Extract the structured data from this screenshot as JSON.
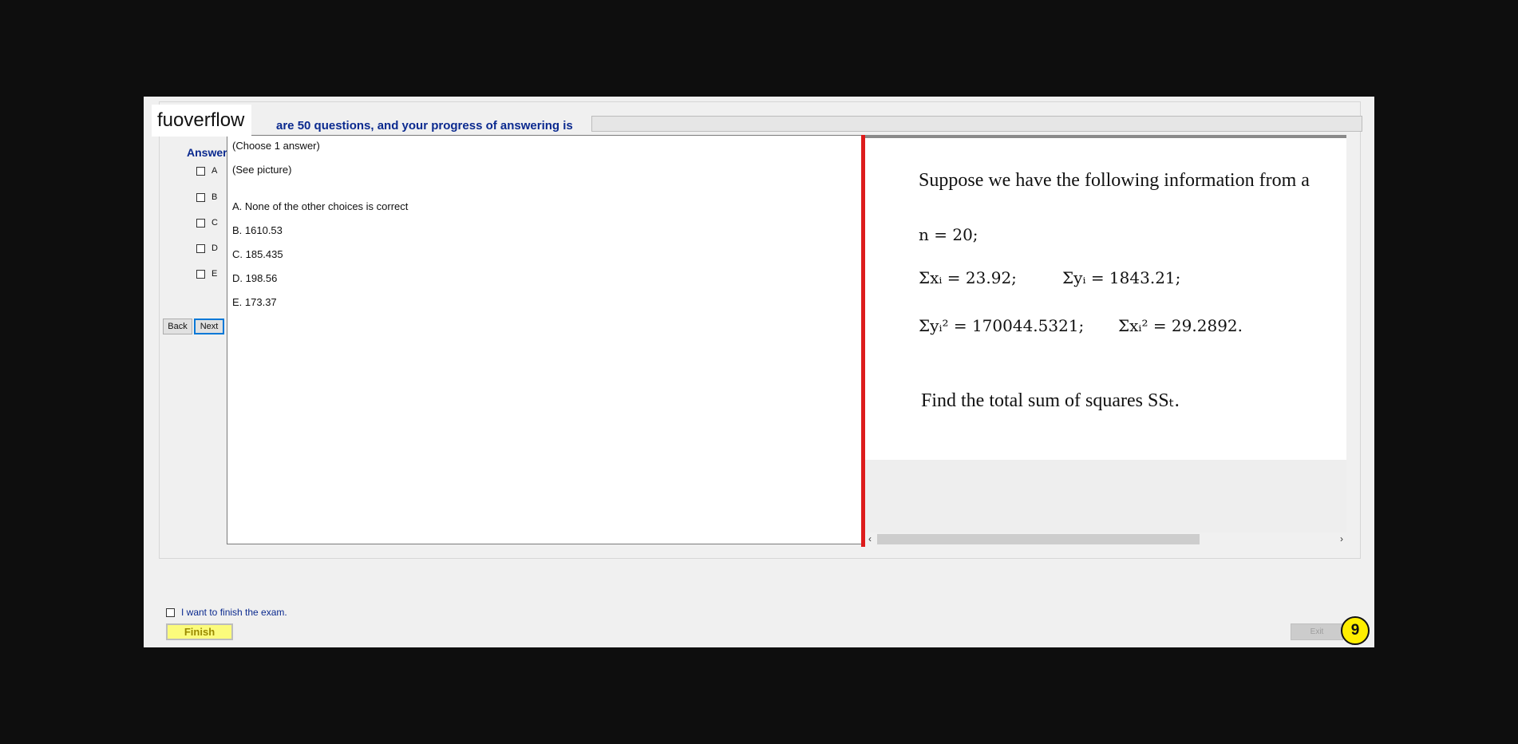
{
  "brand": "fuoverflow",
  "header": {
    "progress_text": "are 50 questions, and your progress of answering is",
    "progress_fraction": 0.0
  },
  "answer_panel": {
    "title": "Answer",
    "options": [
      "A",
      "B",
      "C",
      "D",
      "E"
    ],
    "back_label": "Back",
    "next_label": "Next"
  },
  "question": {
    "instruction": "(Choose 1 answer)",
    "note": "(See picture)",
    "choices": [
      "A.  None of the other choices is correct",
      "B.  1610.53",
      "C.  185.435",
      "D.  198.56",
      "E.  173.37"
    ]
  },
  "picture": {
    "intro": "Suppose we have the following information from a",
    "n_line": "n = 20;",
    "sum_x": "Σxᵢ = 23.92;",
    "sum_y": "Σyᵢ = 1843.21;",
    "sum_y2": "Σyᵢ² = 170044.5321;",
    "sum_x2": "Σxᵢ² = 29.2892.",
    "task": "Find the total sum of squares SSₜ."
  },
  "footer": {
    "finish_checkbox_label": "I want to finish the exam.",
    "finish_label": "Finish",
    "exit_label": "Exit",
    "badge": "9"
  },
  "colors": {
    "divider": "#dd1c1c",
    "badge": "#ffee00",
    "finish_bg": "#fbfb7c",
    "heading_blue": "#0b2a8f"
  }
}
